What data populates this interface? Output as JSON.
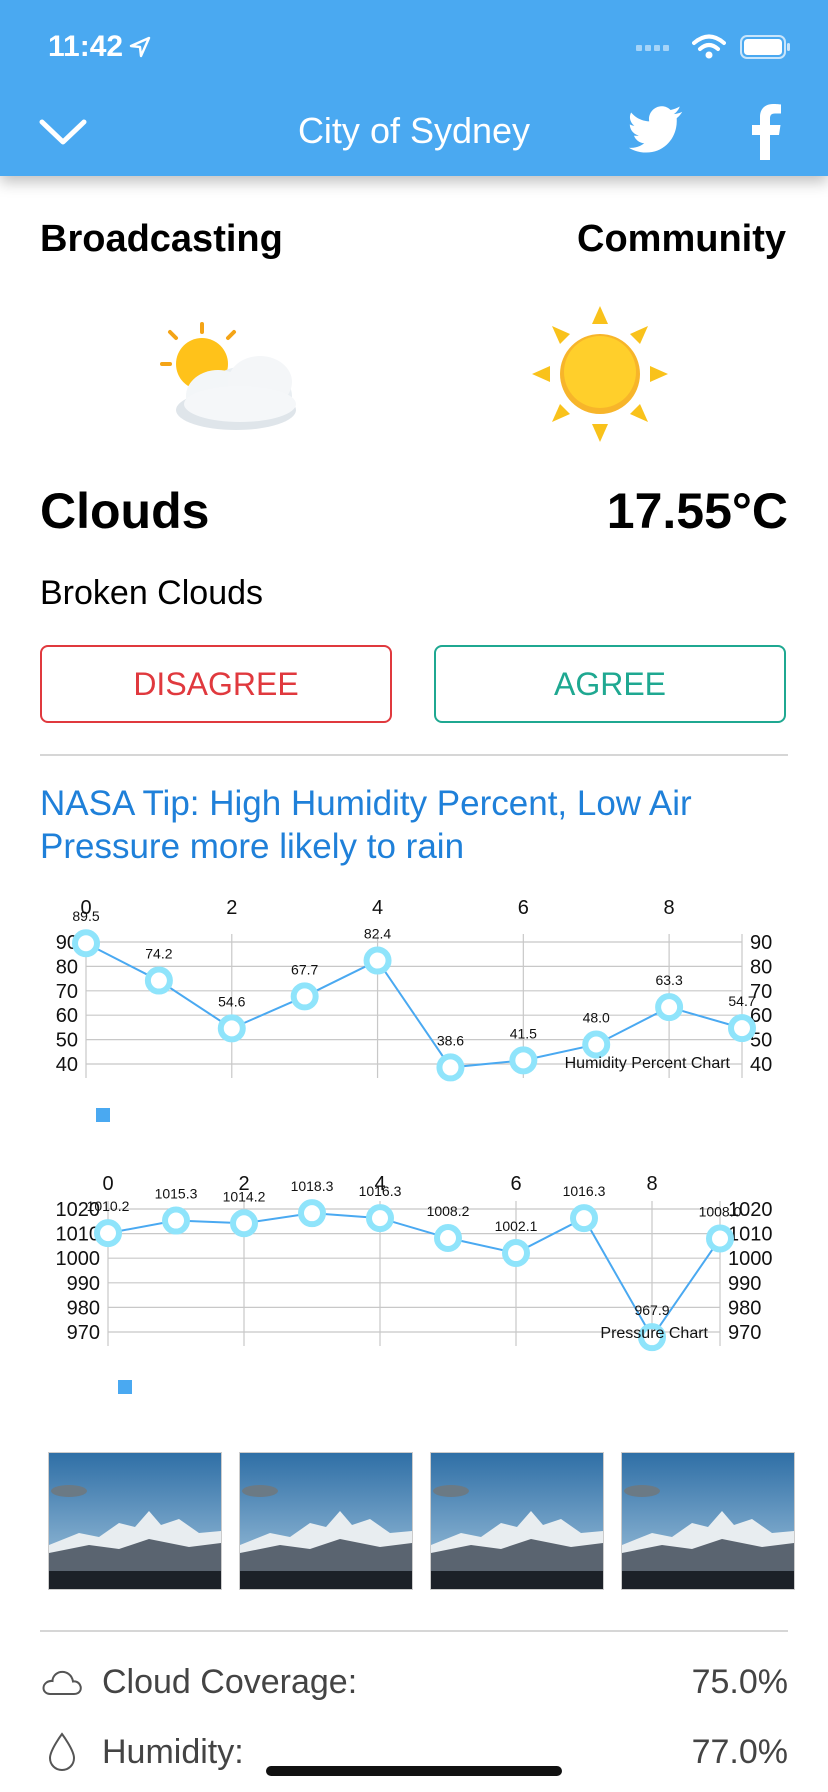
{
  "status_bar": {
    "time": "11:42"
  },
  "nav": {
    "title": "City of Sydney"
  },
  "columns": {
    "left_heading": "Broadcasting",
    "right_heading": "Community",
    "left_emoji": "☁️",
    "left_condition": "Clouds",
    "right_temperature": "17.55°C",
    "description": "Broken Clouds"
  },
  "buttons": {
    "disagree": "DISAGREE",
    "agree": "AGREE"
  },
  "tip": "NASA Tip: High Humidity Percent, Low Air Pressure more likely to rain",
  "chart_data": [
    {
      "type": "line",
      "x": [
        0,
        1,
        2,
        3,
        4,
        5,
        6,
        7,
        8,
        9
      ],
      "x_ticks": [
        "0",
        "2",
        "4",
        "6",
        "8"
      ],
      "values": [
        89.5,
        74.2,
        54.6,
        67.7,
        82.4,
        38.6,
        41.5,
        48.0,
        63.3,
        54.7
      ],
      "value_labels": [
        "89.5",
        "74.2",
        "54.6",
        "67.7",
        "82.4",
        "38.6",
        "41.5",
        "48.0",
        "63.3",
        "54.7"
      ],
      "y_ticks": [
        "90",
        "80",
        "70",
        "60",
        "50",
        "40"
      ],
      "ylim": [
        40,
        90
      ],
      "description": "Humidity Percent Chart",
      "color": "#4aa9f1",
      "marker_color": "#8fe4fb"
    },
    {
      "type": "line",
      "x": [
        0,
        1,
        2,
        3,
        4,
        5,
        6,
        7,
        8,
        9
      ],
      "x_ticks": [
        "0",
        "2",
        "4",
        "6",
        "8"
      ],
      "values": [
        1010.2,
        1015.3,
        1014.2,
        1018.3,
        1016.3,
        1008.2,
        1002.1,
        1016.3,
        967.9,
        1008.0
      ],
      "value_labels": [
        "1010.2",
        "1015.3",
        "1014.2",
        "1018.3",
        "1016.3",
        "1008.2",
        "1002.1",
        "1016.3",
        "967.9",
        "1008.0"
      ],
      "y_ticks": [
        "1020",
        "1010",
        "1000",
        "990",
        "980",
        "970"
      ],
      "ylim": [
        970,
        1020
      ],
      "description": "Pressure Chart",
      "color": "#4aa9f1",
      "marker_color": "#8fe4fb"
    }
  ],
  "stats": [
    {
      "icon": "cloud-icon",
      "label": "Cloud Coverage:",
      "value": "75.0%"
    },
    {
      "icon": "droplet-icon",
      "label": "Humidity:",
      "value": "77.0%"
    }
  ],
  "colors": {
    "nav_bg": "#4aa9f1",
    "disagree": "#e0393e",
    "agree": "#1fa891",
    "tip": "#1f80d9"
  }
}
